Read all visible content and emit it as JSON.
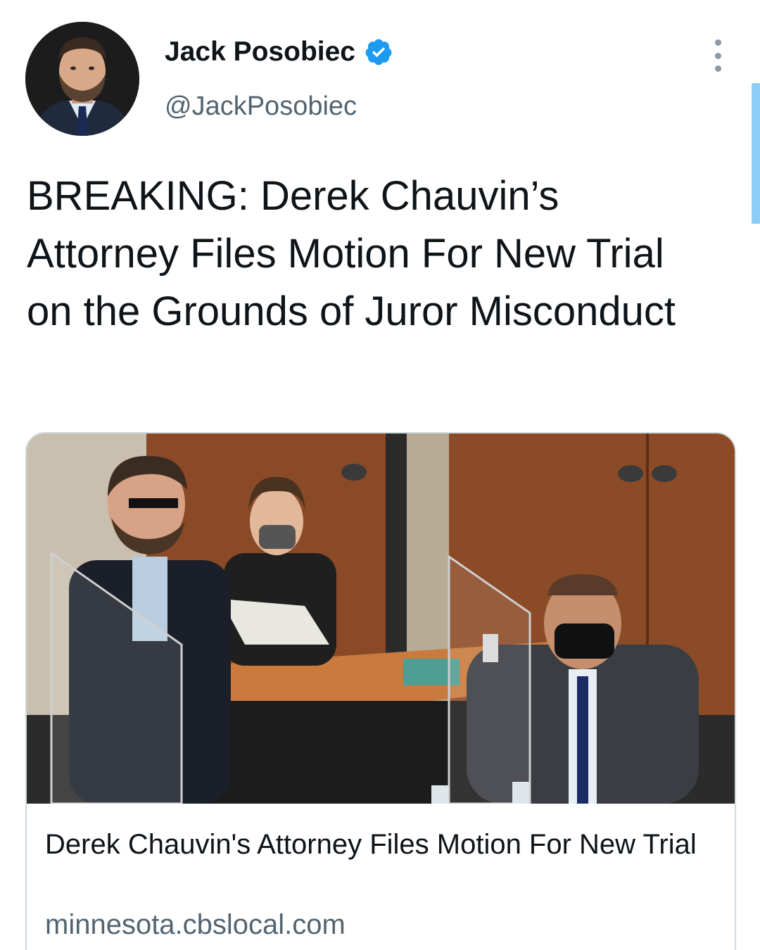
{
  "author": {
    "display_name": "Jack Posobiec",
    "handle": "@JackPosobiec",
    "verified": true
  },
  "tweet": {
    "text": "BREAKING: Derek Chauvin’s Attorney Files Motion For New Trial on the Grounds of Juror Misconduct"
  },
  "link_card": {
    "title": "Derek Chauvin's Attorney Files Motion For New Trial",
    "domain": "minnesota.cbslocal.com"
  },
  "icons": {
    "verified": "verified-badge-icon",
    "more": "more-options-icon"
  },
  "colors": {
    "text_primary": "#0f1419",
    "text_secondary": "#536471",
    "verified_blue": "#1d9bf0",
    "card_border": "#cfd9de"
  }
}
